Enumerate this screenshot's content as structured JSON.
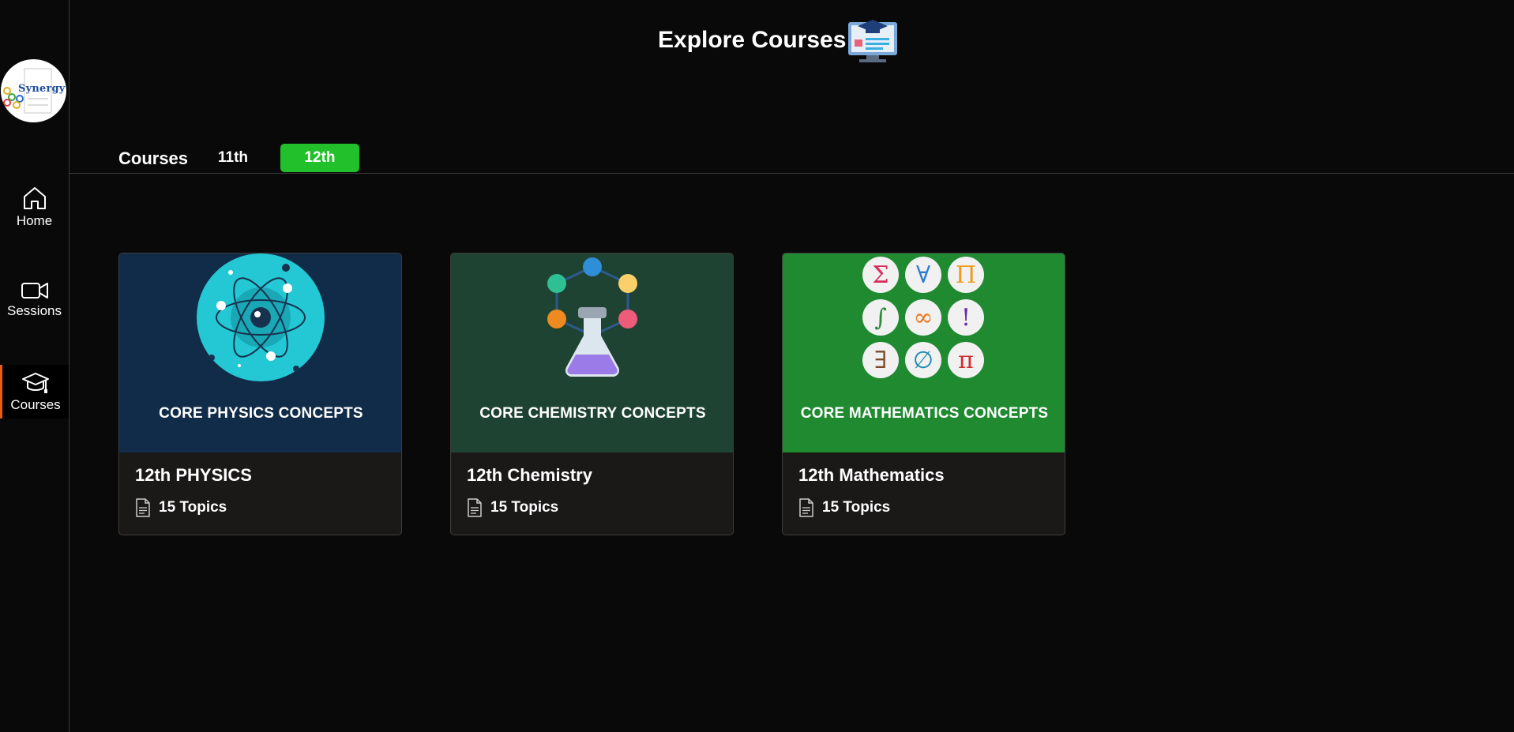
{
  "sidebar": {
    "logo_text": "Synergy",
    "items": [
      {
        "label": "Home",
        "icon": "home-icon"
      },
      {
        "label": "Sessions",
        "icon": "video-camera-icon"
      },
      {
        "label": "Courses",
        "icon": "graduation-cap-icon",
        "active": true
      }
    ]
  },
  "header": {
    "title": "Explore Courses",
    "icon": "course-monitor-icon"
  },
  "tabs": {
    "label": "Courses",
    "items": [
      {
        "label": "11th",
        "active": false
      },
      {
        "label": "12th",
        "active": true
      }
    ],
    "active_color": "#22c02a"
  },
  "courses": [
    {
      "banner_caption": "CORE PHYSICS CONCEPTS",
      "title": "12th PHYSICS",
      "topics": "15 Topics",
      "banner_color": "#102c48"
    },
    {
      "banner_caption": "CORE CHEMISTRY CONCEPTS",
      "title": "12th Chemistry",
      "topics": "15 Topics",
      "banner_color": "#1f4332"
    },
    {
      "banner_caption": "CORE MATHEMATICS CONCEPTS",
      "title": "12th Mathematics",
      "topics": "15 Topics",
      "banner_color": "#208a31"
    }
  ],
  "math_symbols": [
    "Σ",
    "∀",
    "Π",
    "∫",
    "∞",
    "!",
    "∃",
    "∅",
    "π"
  ],
  "colors": {
    "accent_active_nav": "#e85d0c",
    "background": "#0a0909",
    "card": "#1b1818"
  }
}
